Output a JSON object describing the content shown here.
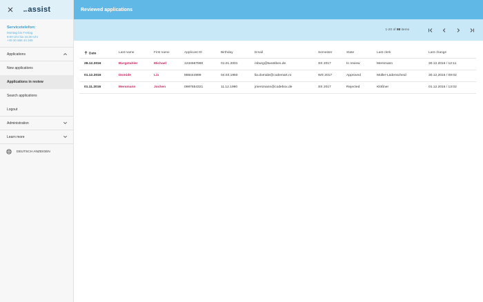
{
  "header": {
    "logo_prefix": "uni",
    "logo_main": "assist",
    "page_title": "Reviewed applications"
  },
  "service": {
    "title": "Servicetelefon:",
    "lines": [
      "Montag bis Freitag",
      "9:00 Uhr bis 15:30 Uhr",
      "+49 30 666 44 345"
    ]
  },
  "nav": {
    "applications": "Applications",
    "new_applications": "New applications",
    "applications_in_review": "Applications in review",
    "search_applications": "Search applications",
    "logout": "Logout",
    "administration": "Administration",
    "learn_more": "Learn more",
    "language": "DEUTSCH ANZEIGEN"
  },
  "pager": {
    "range": "1-20",
    "of_label": "of",
    "total": "98",
    "items_label": "items"
  },
  "table": {
    "columns": [
      "Date",
      "Last name",
      "First name",
      "Applicant ID",
      "Birthday",
      "Email",
      "Semester",
      "State",
      "Last clerk",
      "Last change"
    ],
    "rows": [
      [
        "28.12.2016",
        "Burgstahler",
        "Michael",
        "1234567890",
        "01.01.2001",
        "mburg@twotribes.de",
        "SS 2017",
        "In review",
        "Mersmann",
        "30.12.2016 / 12:11"
      ],
      [
        "01.12.2016",
        "Domide",
        "Lia",
        "888444999",
        "04.03.1950",
        "lia.domide@codemart.ro",
        "WS 2017",
        "Approved",
        "Müller-Lüdenscheid",
        "30.12.2016 / 09:02"
      ],
      [
        "01.11.2016",
        "Mersmann",
        "Jochen",
        "0987654321",
        "11.12.1990",
        "jmersmann@codebox.de",
        "SS 2017",
        "Rejected",
        "Klößner",
        "01.12.2016 / 13:02"
      ]
    ]
  },
  "colors": {
    "topbar": "#5fb8e6",
    "pager_bar": "#c8e8f8",
    "name_accent": "#c8235a",
    "service_text": "#3a9ed4"
  },
  "icons": [
    "close-icon",
    "chevron-up-icon",
    "chevron-down-icon",
    "globe-icon",
    "first-page-icon",
    "prev-page-icon",
    "next-page-icon",
    "last-page-icon",
    "arrow-up-icon"
  ]
}
